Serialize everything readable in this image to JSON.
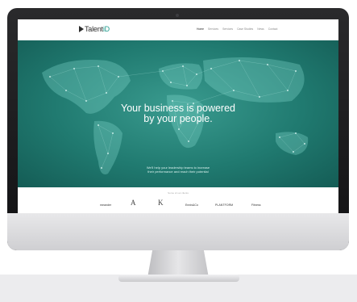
{
  "site": {
    "brand_name": "Talent",
    "brand_accent": "iD",
    "tagline": "",
    "accent_color": "#1d9a8c"
  },
  "nav": {
    "items": [
      "Home",
      "Services",
      "Services",
      "Case Studies",
      "News",
      "Contact"
    ],
    "active_index": 0
  },
  "hero": {
    "title_line1": "Your business is powered",
    "title_line2": "by your people.",
    "subtitle_line1": "We'll help your leadership teams to increase",
    "subtitle_line2": "their performance and reach their potential"
  },
  "clients": {
    "heading": "Some of our clients",
    "logos": [
      "meander",
      "A",
      "K",
      "Ennis&Co",
      "PLANTFORM",
      "Fitness"
    ]
  }
}
